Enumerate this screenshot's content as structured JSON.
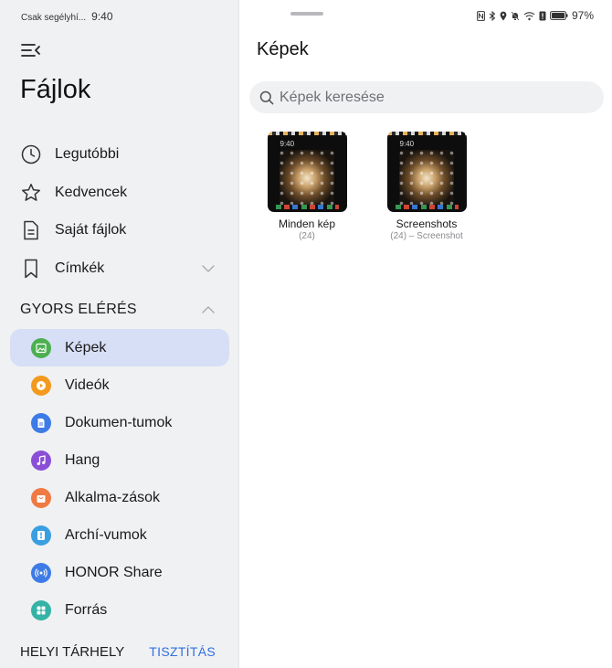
{
  "status_bar": {
    "carrier": "Csak segélyhí...",
    "time": "9:40",
    "battery": "97%"
  },
  "sidebar": {
    "app_title": "Fájlok",
    "nav_items": [
      {
        "label": "Legutóbbi",
        "icon": "clock-icon"
      },
      {
        "label": "Kedvencek",
        "icon": "star-icon"
      },
      {
        "label": "Saját fájlok",
        "icon": "document-icon"
      },
      {
        "label": "Címkék",
        "icon": "bookmark-icon"
      }
    ],
    "quick_access_title": "GYORS ELÉRÉS",
    "quick_items": [
      {
        "label": "Képek",
        "color": "#4caf50",
        "icon": "image-icon",
        "active": true
      },
      {
        "label": "Videók",
        "color": "#f39a1e",
        "icon": "play-icon"
      },
      {
        "label": "Dokumen-tumok",
        "color": "#3d7be6",
        "icon": "doc-icon"
      },
      {
        "label": "Hang",
        "color": "#8a4fd6",
        "icon": "music-icon"
      },
      {
        "label": "Alkalma-zások",
        "color": "#ef7a43",
        "icon": "bag-icon"
      },
      {
        "label": "Archí-vumok",
        "color": "#3a9fe0",
        "icon": "archive-icon"
      },
      {
        "label": "HONOR Share",
        "color": "#3d7be6",
        "icon": "share-icon"
      },
      {
        "label": "Forrás",
        "color": "#34b3a6",
        "icon": "grid-icon"
      }
    ],
    "local_storage_title": "HELYI TÁRHELY",
    "clean_label": "TISZTÍTÁS"
  },
  "content": {
    "title": "Képek",
    "search_placeholder": "Képek keresése",
    "thumb_time": "9:40",
    "albums": [
      {
        "name": "Minden kép",
        "meta": "(24)"
      },
      {
        "name": "Screenshots",
        "meta": "(24) – Screenshot"
      }
    ]
  },
  "colors": {
    "accent": "#2f6fe0",
    "active_bg": "#d6dff5",
    "sidebar_bg": "#f0f1f3"
  }
}
